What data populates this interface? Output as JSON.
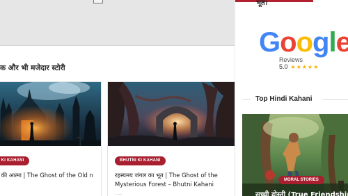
{
  "colors": {
    "accent": "#b3202f",
    "badge": "#a8202f",
    "google_blue": "#4285f4",
    "google_red": "#ea4335",
    "google_yellow": "#fbbc05",
    "google_green": "#34a853",
    "star": "#f4b400"
  },
  "main": {
    "section_heading": "क और भी मजेदार स्टोरी",
    "cards": [
      {
        "category": "I KI KAHANI",
        "title": "ली की आत्मा | The Ghost of the Old n",
        "meta": ""
      },
      {
        "category": "BHUTNI KI KAHANI",
        "title": "रहस्यमय जंगल का भूत | The Ghost of the Mysterious Forest – Bhutni Kahani",
        "meta": "◦ —"
      }
    ]
  },
  "sidebar": {
    "top_text": "भूत।",
    "google_reviews": {
      "letters": [
        "G",
        "o",
        "o",
        "g",
        "l",
        "e"
      ],
      "label": "Reviews",
      "rating": "5.0",
      "stars": "★★★★★"
    },
    "heading": "Top Hindi Kahani",
    "featured": {
      "category": "MORAL STORIES",
      "title": "सच्ची दोस्ती (True Friendship"
    }
  }
}
